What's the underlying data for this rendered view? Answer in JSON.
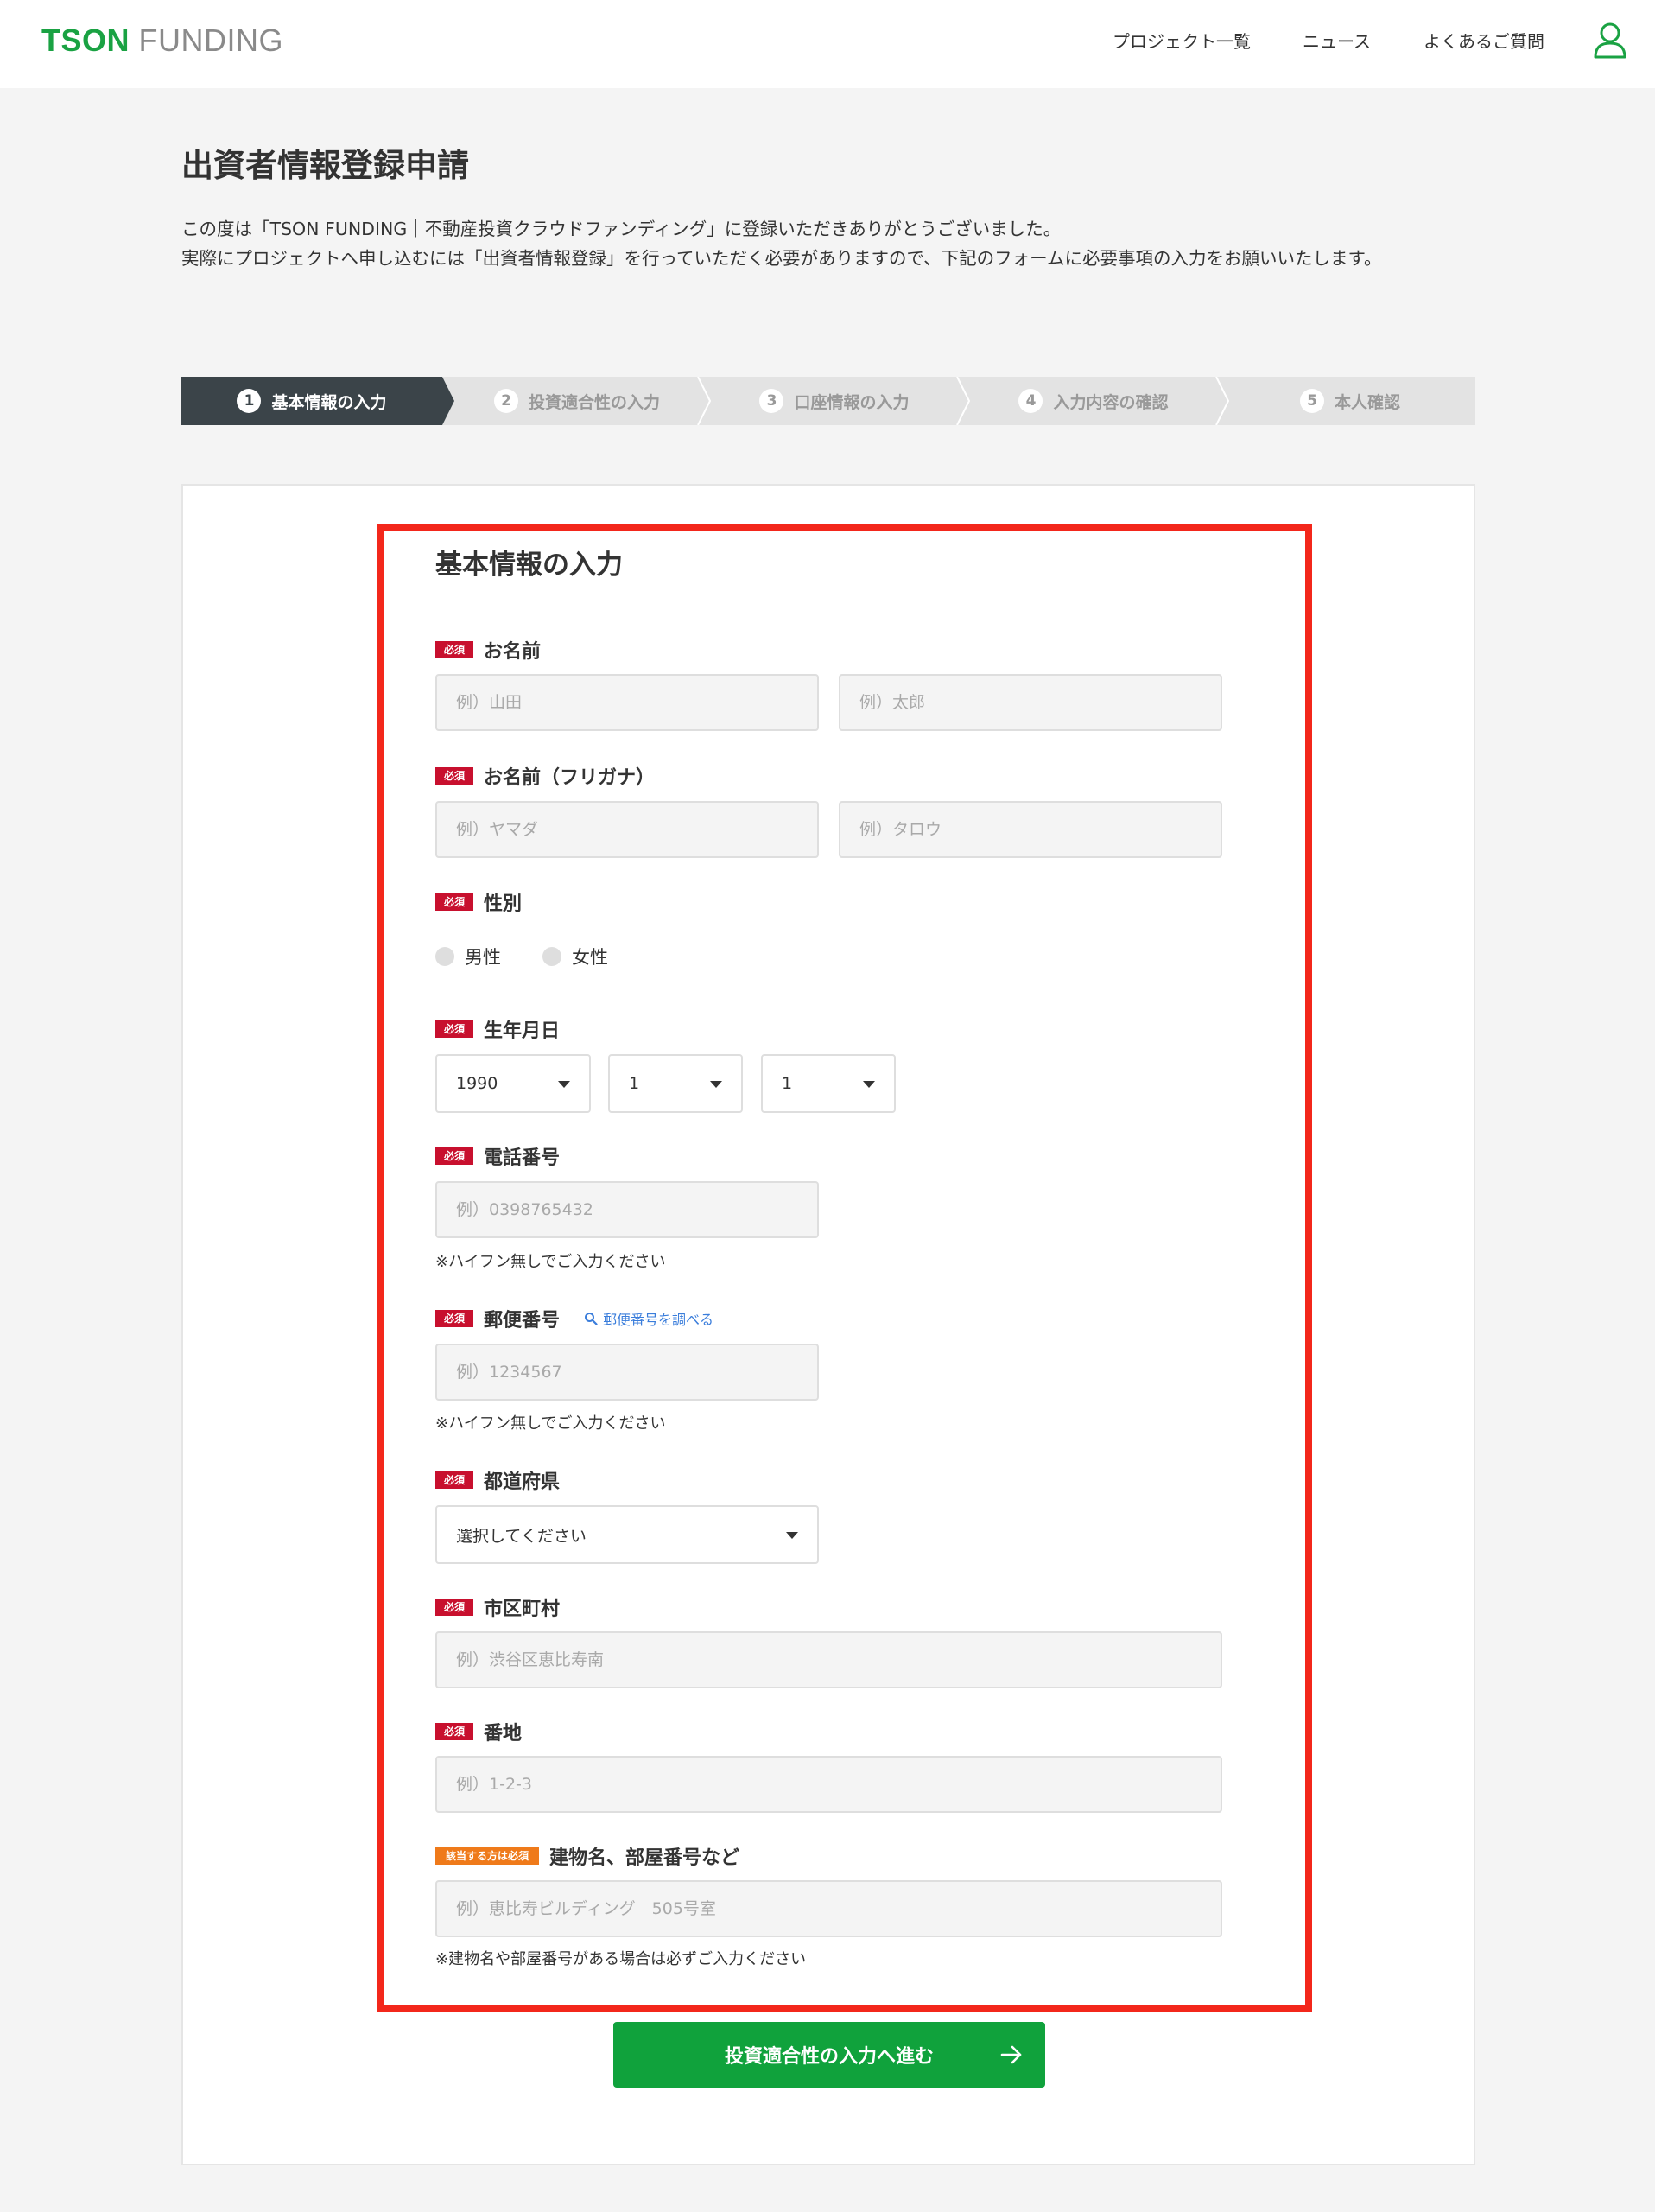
{
  "header": {
    "logo_brand": "TSON",
    "logo_rest": "FUNDING",
    "nav": [
      "プロジェクト一覧",
      "ニュース",
      "よくあるご質問"
    ],
    "user_icon": "user-icon",
    "brand_color": "#1aa243"
  },
  "page": {
    "title": "出資者情報登録申請",
    "intro_line1": "この度は「TSON FUNDING｜不動産投資クラウドファンディング」に登録いただきありがとうございました。",
    "intro_line2": "実際にプロジェクトへ申し込むには「出資者情報登録」を行っていただく必要がありますので、下記のフォームに必要事項の入力をお願いいたします。"
  },
  "steps": [
    {
      "num": "1",
      "label": "基本情報の入力",
      "active": true
    },
    {
      "num": "2",
      "label": "投資適合性の入力",
      "active": false
    },
    {
      "num": "3",
      "label": "口座情報の入力",
      "active": false
    },
    {
      "num": "4",
      "label": "入力内容の確認",
      "active": false
    },
    {
      "num": "5",
      "label": "本人確認",
      "active": false
    }
  ],
  "form": {
    "section_title": "基本情報の入力",
    "required_badge": "必須",
    "optional_badge": "該当する方は必須",
    "name": {
      "label": "お名前",
      "last_placeholder": "例）山田",
      "first_placeholder": "例）太郎"
    },
    "kana": {
      "label": "お名前（フリガナ）",
      "last_placeholder": "例）ヤマダ",
      "first_placeholder": "例）タロウ"
    },
    "gender": {
      "label": "性別",
      "options": [
        "男性",
        "女性"
      ]
    },
    "birthday": {
      "label": "生年月日",
      "year": "1990",
      "month": "1",
      "day": "1"
    },
    "phone": {
      "label": "電話番号",
      "placeholder": "例）0398765432",
      "note": "※ハイフン無しでご入力ください"
    },
    "postal": {
      "label": "郵便番号",
      "lookup": "郵便番号を調べる",
      "placeholder": "例）1234567",
      "note": "※ハイフン無しでご入力ください"
    },
    "prefecture": {
      "label": "都道府県",
      "value": "選択してください"
    },
    "city": {
      "label": "市区町村",
      "placeholder": "例）渋谷区恵比寿南"
    },
    "address": {
      "label": "番地",
      "placeholder": "例）1-2-3"
    },
    "building": {
      "label": "建物名、部屋番号など",
      "placeholder": "例）恵比寿ビルディング　505号室",
      "note": "※建物名や部屋番号がある場合は必ずご入力ください"
    },
    "submit_label": "投資適合性の入力へ進む"
  },
  "colors": {
    "required": "#c8102e",
    "optional": "#ef7a1a",
    "submit": "#10a23c",
    "step_active": "#3b4449",
    "step_inactive": "#e3e3e3",
    "highlight": "#f3271b"
  }
}
